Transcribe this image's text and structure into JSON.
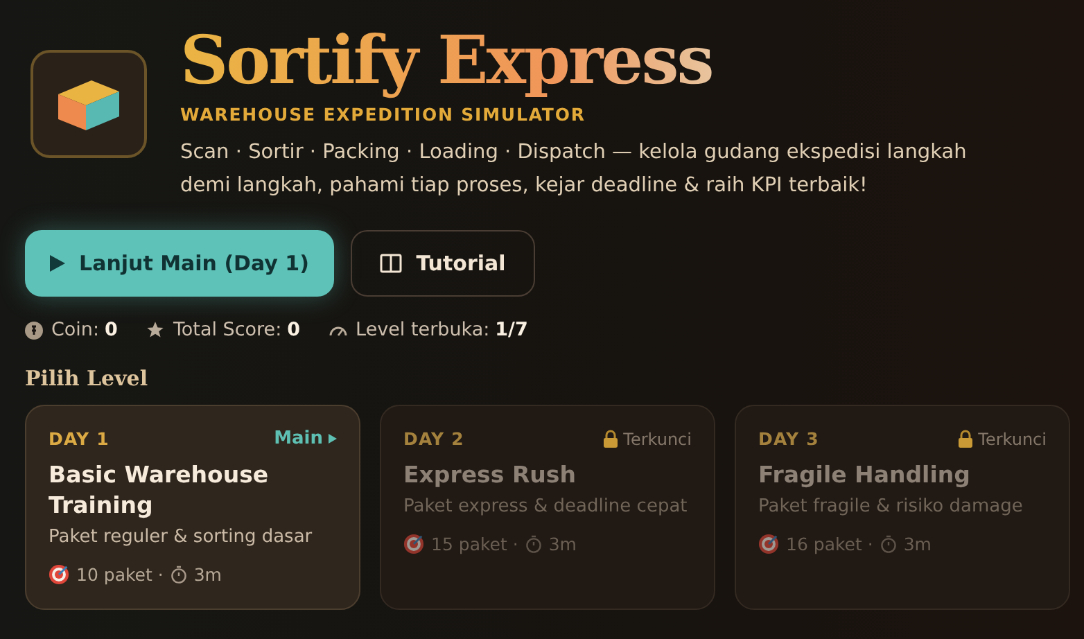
{
  "header": {
    "title": "Sortify Express",
    "subtitle": "WAREHOUSE EXPEDITION SIMULATOR",
    "description": "Scan · Sortir · Packing · Loading · Dispatch — kelola gudang ekspedisi langkah demi langkah, pahami tiap proses, kejar deadline & raih KPI terbaik!"
  },
  "actions": [
    {
      "kind": "primary",
      "label": "Lanjut Main (Day 1)"
    },
    {
      "kind": "secondary",
      "label": "Tutorial"
    }
  ],
  "stats": [
    {
      "kind": "coin",
      "label": "Coin:",
      "value": "0"
    },
    {
      "kind": "score",
      "label": "Total Score:",
      "value": "0"
    },
    {
      "kind": "level",
      "label": "Level terbuka:",
      "value": "1/7"
    }
  ],
  "section_title": "Pilih Level",
  "levels": [
    {
      "day": "DAY 1",
      "status": "Main",
      "locked": false,
      "title": "Basic Warehouse Training",
      "description": "Paket reguler & sorting dasar",
      "packages": "10 paket ·",
      "time": "3m"
    },
    {
      "day": "DAY 2",
      "status": "Terkunci",
      "locked": true,
      "title": "Express Rush",
      "description": "Paket express & deadline cepat",
      "packages": "15 paket ·",
      "time": "3m"
    },
    {
      "day": "DAY 3",
      "status": "Terkunci",
      "locked": true,
      "title": "Fragile Handling",
      "description": "Paket fragile & risiko damage",
      "packages": "16 paket ·",
      "time": "3m"
    }
  ]
}
